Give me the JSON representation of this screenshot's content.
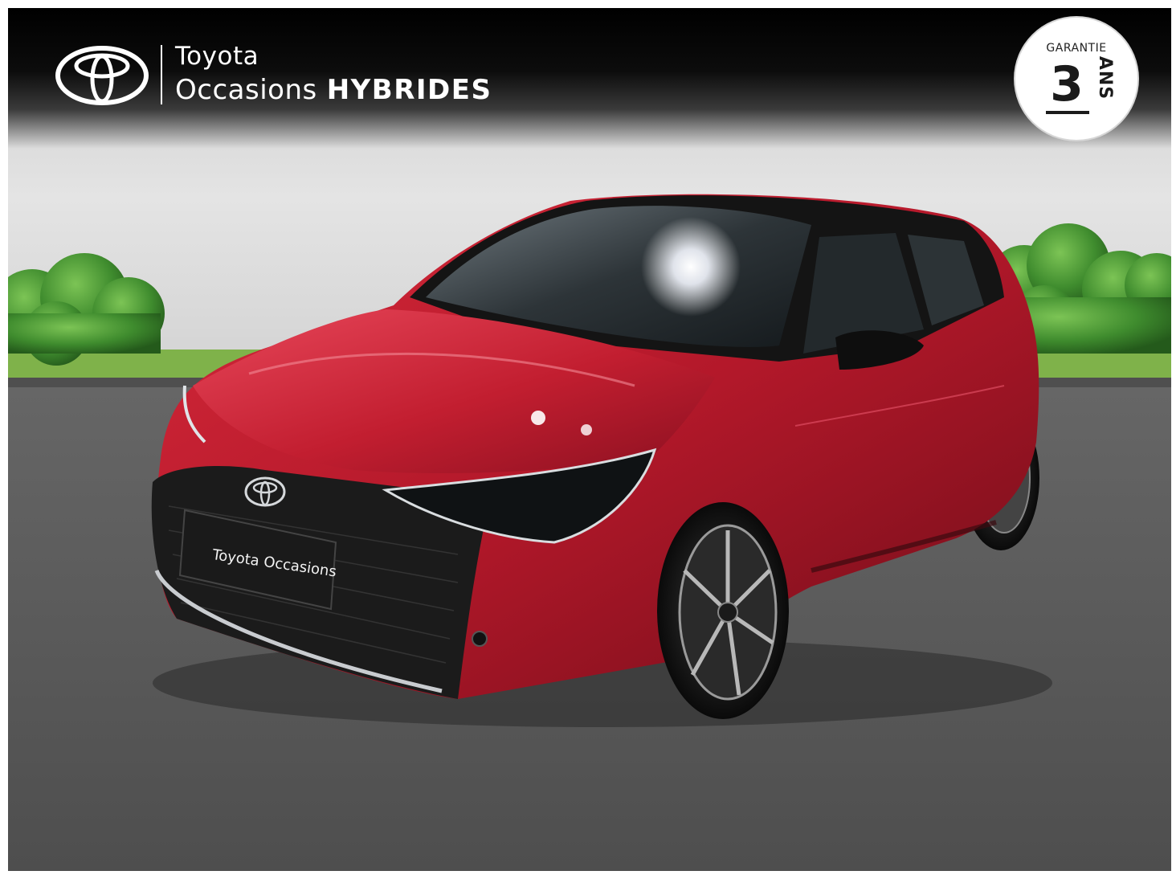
{
  "header": {
    "brand_name": "Toyota",
    "brand_sub": "Occasions",
    "brand_emphasis": "HYBRIDES"
  },
  "badge": {
    "top_text": "GARANTIE",
    "number": "3",
    "unit": "ANS"
  },
  "plate": {
    "brand": "Toyota",
    "sub": "Occasions"
  },
  "vehicle": {
    "body_color": "#b3182a",
    "roof_color": "#111111"
  },
  "colors": {
    "background_wall": "#d8d8d8",
    "grass": "#7fb24a",
    "hedge": "#3f8c2e",
    "asphalt": "#595959",
    "header": "#000000"
  }
}
